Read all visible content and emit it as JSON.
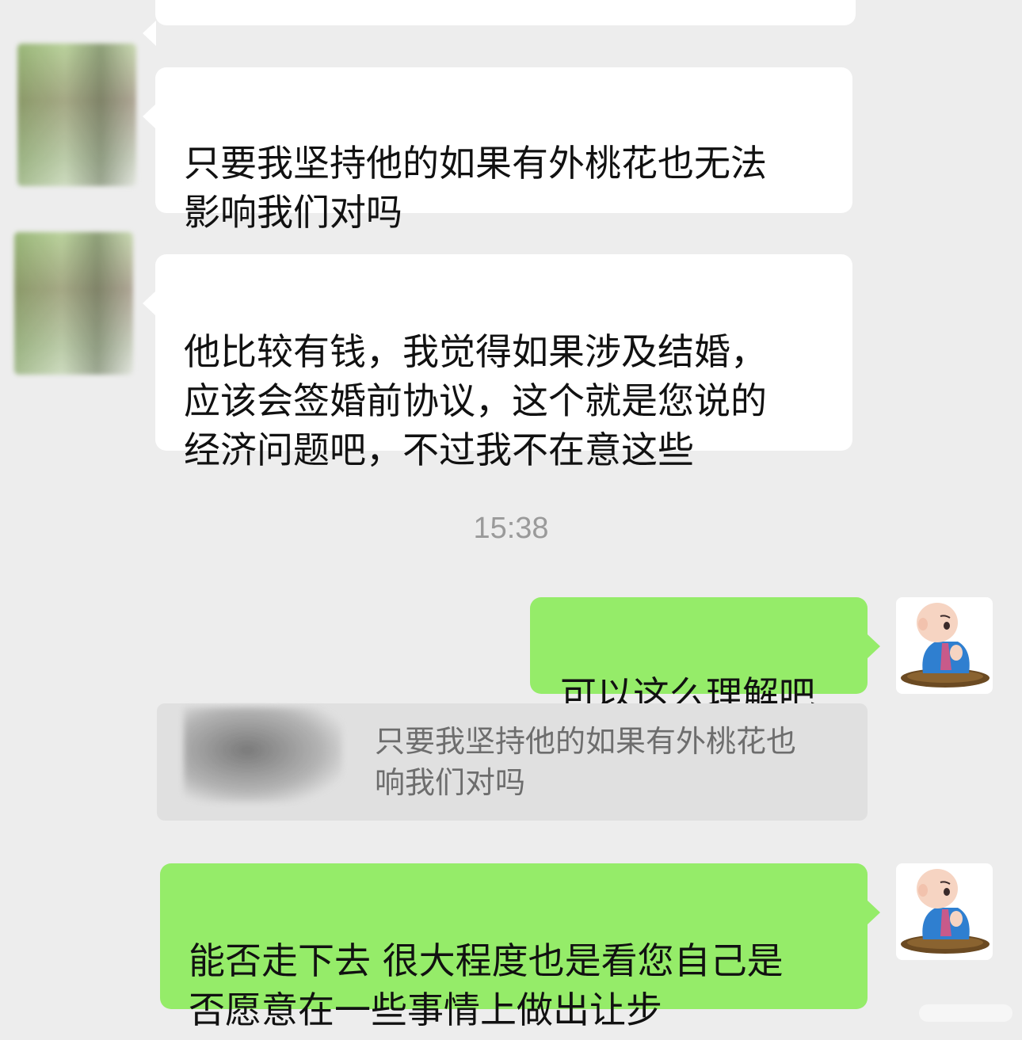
{
  "messages": [
    {
      "side": "left",
      "text": "只要我坚持他的如果有外桃花也无法\n影响我们对吗"
    },
    {
      "side": "left",
      "text": "他比较有钱，我觉得如果涉及结婚，\n应该会签婚前协议，这个就是您说的\n经济问题吧，不过我不在意这些"
    },
    {
      "side": "right",
      "text": "可以这么理解吧"
    },
    {
      "side": "right",
      "text": "能否走下去 很大程度也是看您自己是\n否愿意在一些事情上做出让步"
    }
  ],
  "timestamp": "15:38",
  "quote": {
    "text": "只要我坚持他的如果有外桃花也\n响我们对吗"
  },
  "avatars": {
    "other_user": "blurred-avatar",
    "self": "monk-cartoon-avatar"
  }
}
